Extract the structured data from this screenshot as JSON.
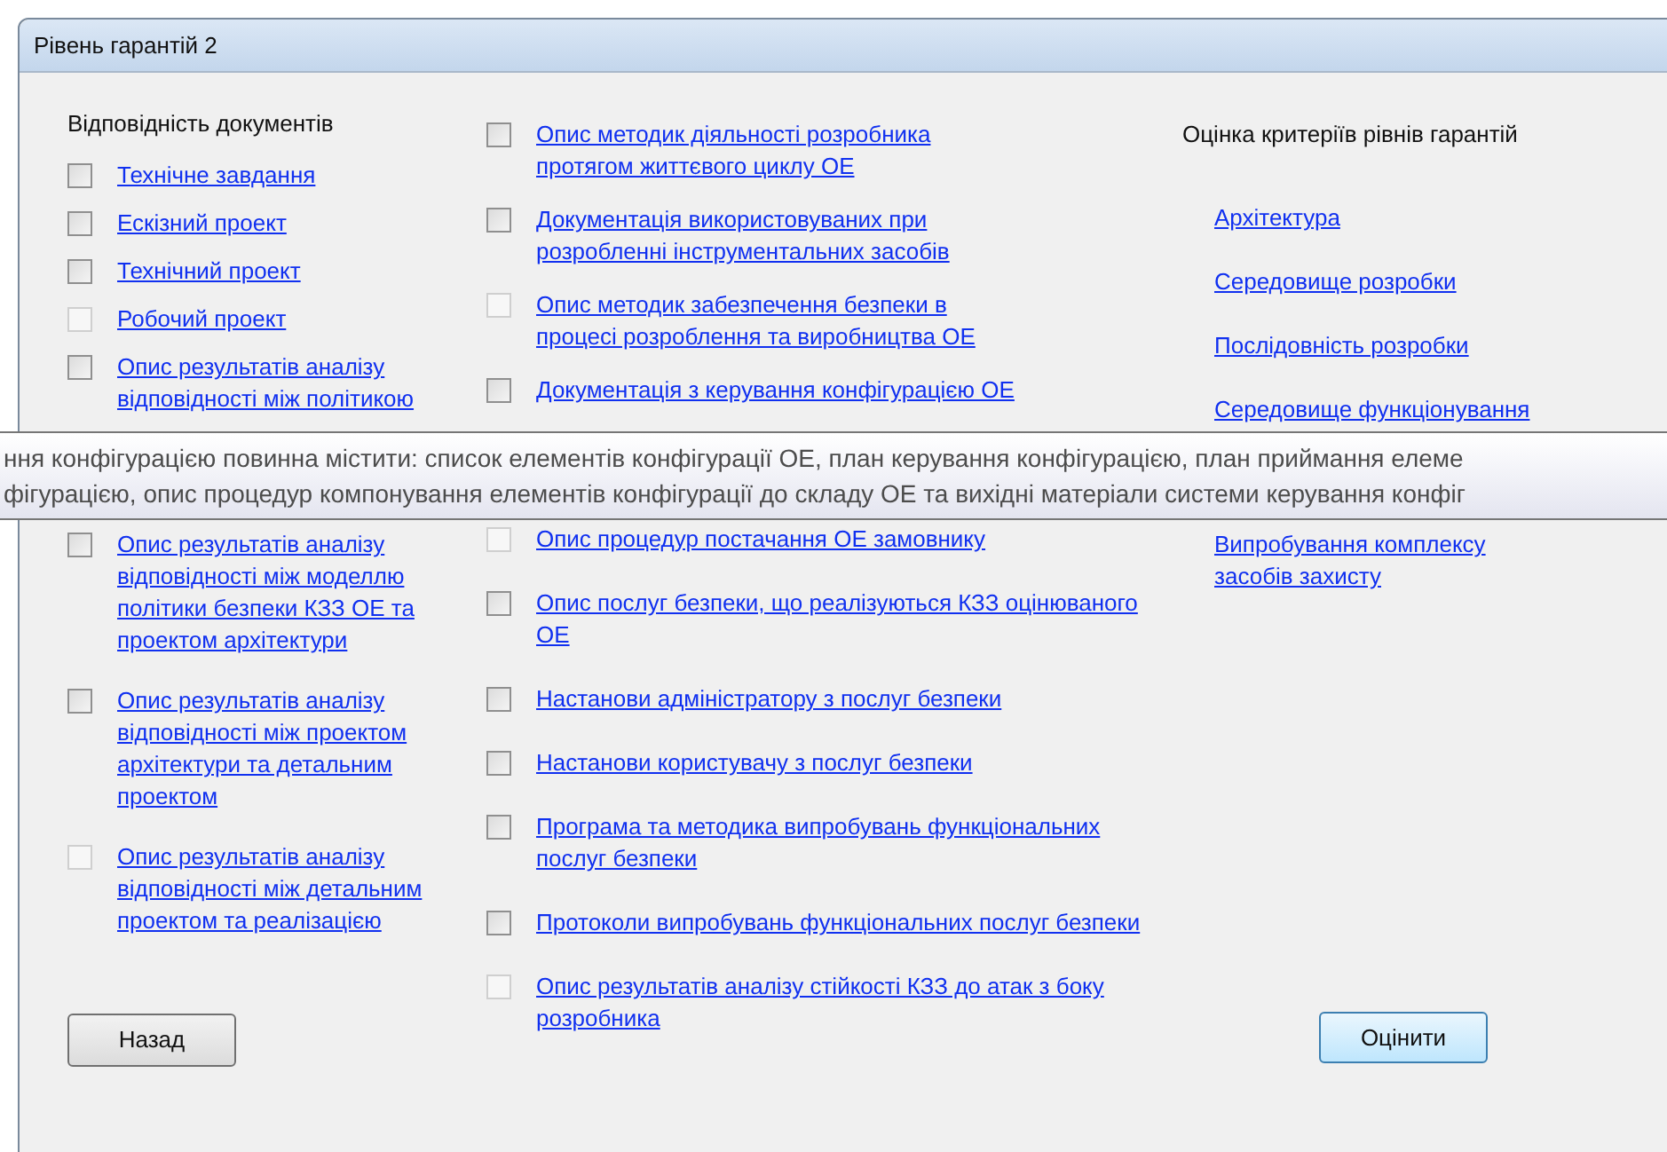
{
  "window": {
    "title": "Рівень гарантій 2"
  },
  "documents": {
    "heading": "Відповідність документів",
    "column_1": [
      {
        "label": "Технічне завдання",
        "checked": false,
        "disabled": false
      },
      {
        "label": "Ескізний проект",
        "checked": false,
        "disabled": false
      },
      {
        "label": "Технічний проект",
        "checked": false,
        "disabled": false
      },
      {
        "label": "Робочий проект",
        "checked": false,
        "disabled": true
      },
      {
        "label": "Опис результатів аналізу відповідності між політикою",
        "checked": false,
        "disabled": false
      },
      {
        "label": "Опис результатів аналізу відповідності між моделлю політики безпеки КЗЗ ОЕ та проектом архітектури",
        "checked": false,
        "disabled": false
      },
      {
        "label": "Опис результатів аналізу відповідності між проектом архітектури та детальним проектом",
        "checked": false,
        "disabled": false
      },
      {
        "label": "Опис результатів аналізу відповідності між детальним проектом та реалізацією",
        "checked": false,
        "disabled": true
      }
    ],
    "column_2": [
      {
        "label": "Опис методик діяльності розробника протягом життєвого циклу ОЕ",
        "checked": false,
        "disabled": false
      },
      {
        "label": "Документація використовуваних при розробленні інструментальних засобів",
        "checked": false,
        "disabled": false
      },
      {
        "label": "Опис методик забезпечення безпеки в процесі розроблення та виробництва ОЕ",
        "checked": false,
        "disabled": true
      },
      {
        "label": "Документація з керування конфігурацією ОЕ",
        "checked": false,
        "disabled": false
      },
      {
        "label": "Опис процедур постачання ОЕ замовнику",
        "checked": false,
        "disabled": true
      },
      {
        "label": "Опис послуг безпеки, що реалізуються КЗЗ оцінюваного ОЕ",
        "checked": false,
        "disabled": false
      },
      {
        "label": "Настанови адміністратору з послуг безпеки",
        "checked": false,
        "disabled": false
      },
      {
        "label": "Настанови користувачу з послуг безпеки",
        "checked": false,
        "disabled": false
      },
      {
        "label": "Програма та методика випробувань функціональних послуг безпеки",
        "checked": false,
        "disabled": false
      },
      {
        "label": "Протоколи випробувань функціональних послуг безпеки",
        "checked": false,
        "disabled": false
      },
      {
        "label": "Опис результатів аналізу стійкості КЗЗ до атак з боку розробника",
        "checked": false,
        "disabled": true
      }
    ]
  },
  "criteria": {
    "heading": "Оцінка критеріїв рівнів гарантій",
    "links": [
      "Архітектура",
      "Середовище розробки",
      "Послідовність розробки",
      "Середовище функціонування",
      "Випробування комплексу засобів захисту"
    ]
  },
  "buttons": {
    "back": "Назад",
    "evaluate": "Оцінити"
  },
  "tooltip": {
    "lines": [
      "ння конфігурацією повинна містити: список елементів конфігурації ОЕ, план керування конфігурацією, план приймання елеме",
      "фігурацією, опис процедур компонування елементів конфігурації до складу ОЕ та вихідні матеріали системи керування конфіг"
    ]
  }
}
